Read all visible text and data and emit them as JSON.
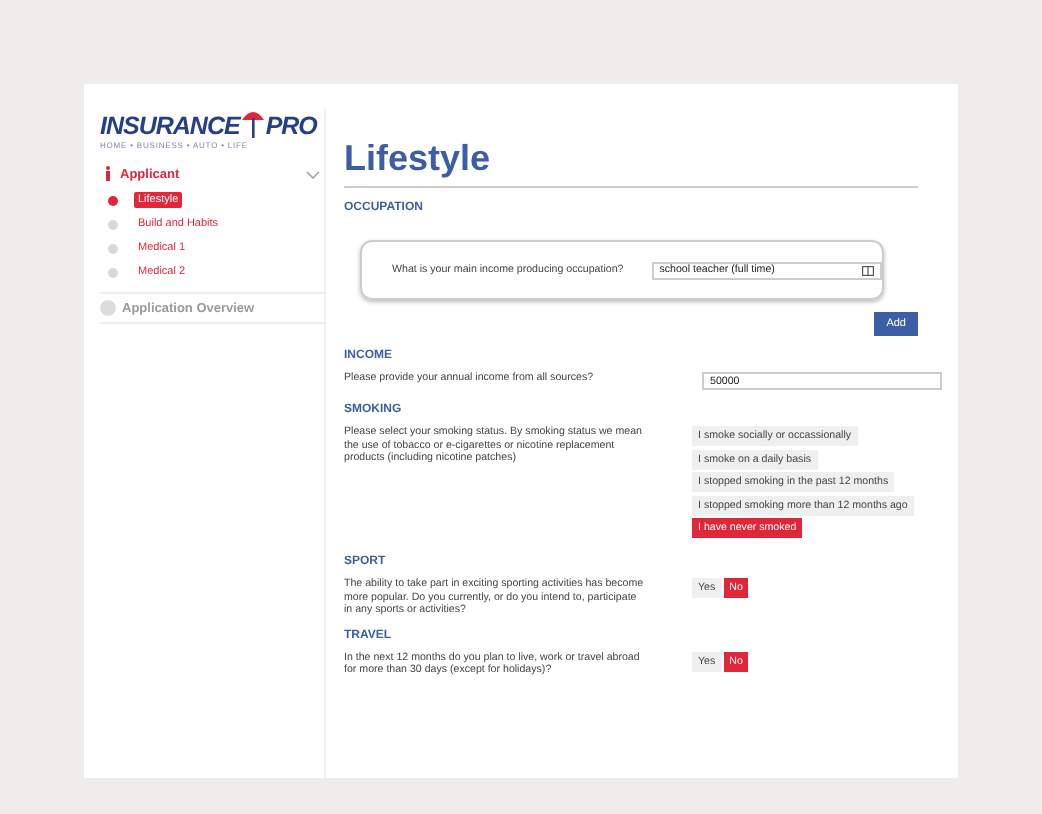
{
  "logo": {
    "left": "INSURANCE",
    "right": "PRO",
    "tagline": "HOME • BUSINESS • AUTO • LIFE"
  },
  "sidebar": {
    "section": {
      "label": "Applicant",
      "expanded": true,
      "children": [
        {
          "label": "Lifestyle",
          "selected": true
        },
        {
          "label": "Build and Habits",
          "selected": false
        },
        {
          "label": "Medical 1",
          "selected": false
        },
        {
          "label": "Medical 2",
          "selected": false
        }
      ]
    },
    "overview": {
      "label": "Application Overview",
      "disabled": true
    }
  },
  "page": {
    "title": "Lifestyle",
    "occupation": {
      "heading": "OCCUPATION",
      "question": "What is your main income producing occupation?",
      "value": "school teacher (full time)",
      "add": "Add"
    },
    "income": {
      "heading": "INCOME",
      "question": "Please provide your annual income from all sources?",
      "value": "50000"
    },
    "smoking": {
      "heading": "SMOKING",
      "question": "Please select your smoking status. By smoking status we mean the use of tobacco or e-cigarettes or nicotine replacement products (including nicotine patches)",
      "options": [
        {
          "label": "I smoke socially or occassionally",
          "selected": false
        },
        {
          "label": "I smoke on a daily basis",
          "selected": false
        },
        {
          "label": "I stopped smoking in the past 12 months",
          "selected": false
        },
        {
          "label": "I stopped smoking more than 12 months ago",
          "selected": false
        },
        {
          "label": "I have never smoked",
          "selected": true
        }
      ]
    },
    "yesno": [
      {
        "heading": "SPORT",
        "question": "The ability to take part in exciting sporting activities has become more popular. Do you currently, or do you intend to, participate in any sports or activities?",
        "options": [
          {
            "label": "Yes",
            "selected": false
          },
          {
            "label": "No",
            "selected": true
          }
        ]
      },
      {
        "heading": "TRAVEL",
        "question": "In the next 12 months do you plan to live, work or travel abroad for more than 30 days (except for holidays)?",
        "options": [
          {
            "label": "Yes",
            "selected": false
          },
          {
            "label": "No",
            "selected": true
          }
        ]
      }
    ]
  }
}
